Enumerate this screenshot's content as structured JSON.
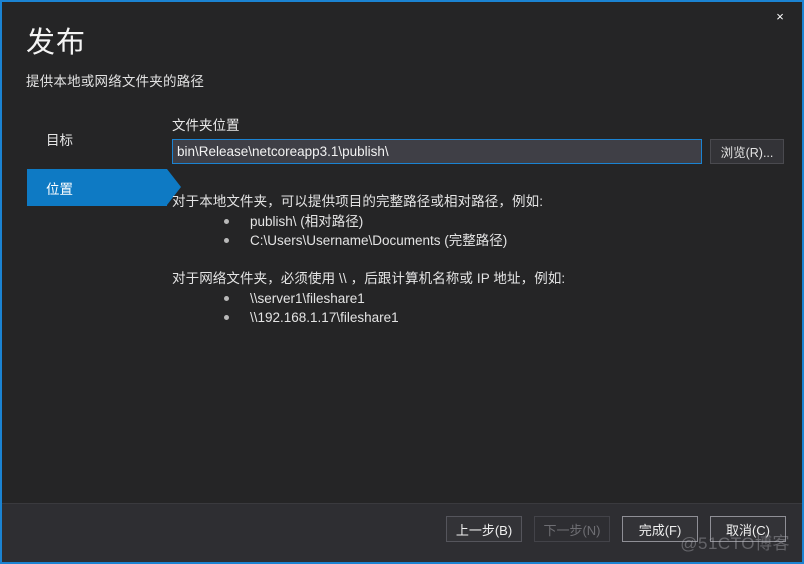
{
  "window": {
    "close_label": "×",
    "accent_color": "#0e7ac4",
    "border_color": "#1b83d2",
    "background_color": "#252526",
    "footer_color": "#2e2e32"
  },
  "header": {
    "title": "发布",
    "subtitle": "提供本地或网络文件夹的路径"
  },
  "sidebar": {
    "items": [
      {
        "label": "目标",
        "active": false
      },
      {
        "label": "位置",
        "active": true
      }
    ]
  },
  "main": {
    "field_label": "文件夹位置",
    "path_value": "bin\\Release\\netcoreapp3.1\\publish\\",
    "path_placeholder": "",
    "browse_label": "浏览(R)...",
    "help": {
      "local_intro": "对于本地文件夹，可以提供项目的完整路径或相对路径，例如:",
      "local_items": [
        "publish\\ (相对路径)",
        "C:\\Users\\Username\\Documents (完整路径)"
      ],
      "network_intro": "对于网络文件夹，必须使用 \\\\ ，后跟计算机名称或 IP 地址，例如:",
      "network_items": [
        "\\\\server1\\fileshare1",
        "\\\\192.168.1.17\\fileshare1"
      ]
    }
  },
  "footer": {
    "back_label": "上一步(B)",
    "next_label": "下一步(N)",
    "finish_label": "完成(F)",
    "cancel_label": "取消(C)",
    "watermark": "@51CTO博客"
  }
}
